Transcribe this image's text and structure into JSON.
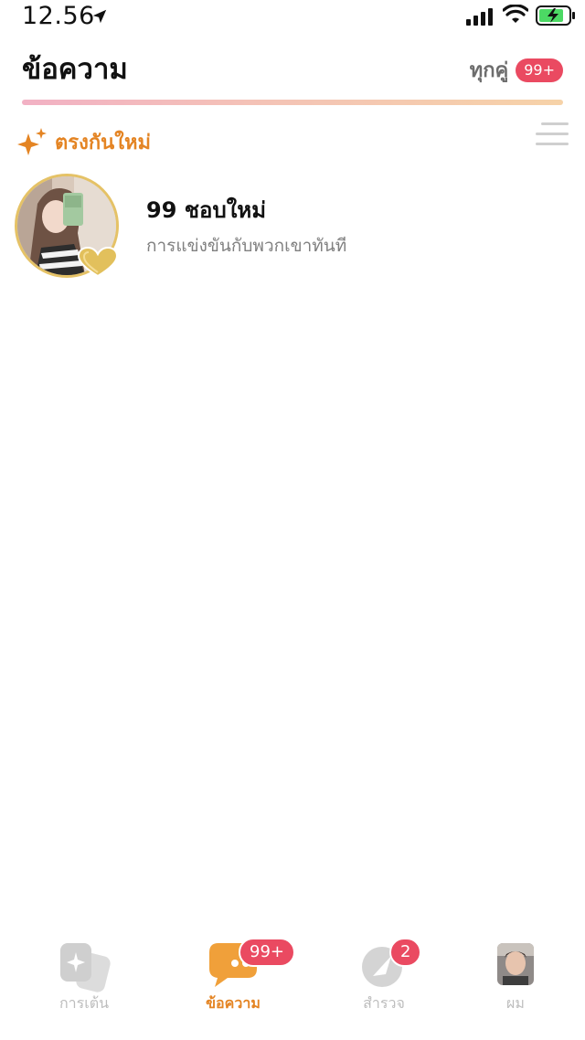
{
  "status_bar": {
    "time": "12.56"
  },
  "header": {
    "title": "ข้อความ",
    "filter_label": "ทุกคู่",
    "filter_badge": "99+"
  },
  "new_matches": {
    "title": "ตรงกันใหม่",
    "item": {
      "title": "99 ชอบใหม่",
      "subtitle": "การแข่งขันกับพวกเขาทันที"
    }
  },
  "tabs": [
    {
      "label": "การเต้น",
      "icon": "dance-cards-icon",
      "active": false
    },
    {
      "label": "ข้อความ",
      "icon": "chat-bubble-icon",
      "active": true,
      "badge": "99+"
    },
    {
      "label": "สำรวจ",
      "icon": "explore-icon",
      "active": false,
      "badge": "2"
    },
    {
      "label": "ผม",
      "icon": "profile-avatar",
      "active": false
    }
  ],
  "colors": {
    "accent": "#e48423",
    "badge": "#ea4a61",
    "ring_gold": "#e5c266",
    "tab_inactive": "#bdbdbd"
  }
}
